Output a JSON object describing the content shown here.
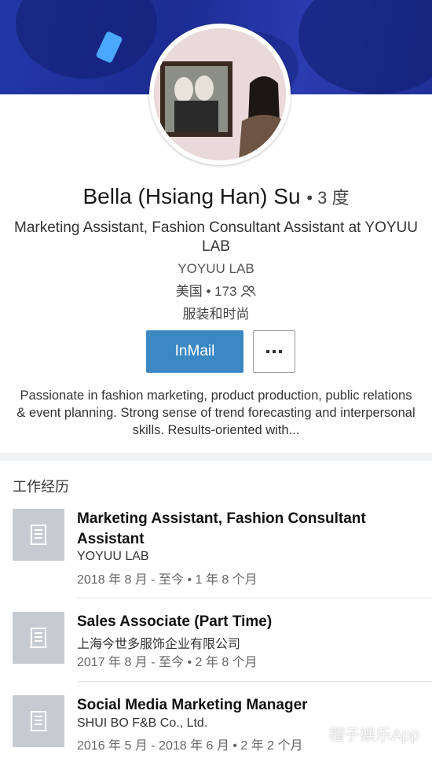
{
  "profile": {
    "name": "Bella (Hsiang Han) Su",
    "degree": "• 3 度",
    "headline": "Marketing Assistant, Fashion Consultant Assistant at YOYUU LAB",
    "company": "YOYUU LAB",
    "location": "美国 • 173",
    "industry": "服装和时尚",
    "summary": "Passionate in fashion marketing, product production, public relations & event planning. Strong sense of trend forecasting and interpersonal skills. Results-oriented with..."
  },
  "actions": {
    "inmail_label": "InMail"
  },
  "experience": {
    "section_title": "工作经历",
    "items": [
      {
        "title": "Marketing Assistant, Fashion Consultant Assistant",
        "company": "YOYUU LAB",
        "dates": "2018 年 8 月 - 至今 • 1 年 8 个月"
      },
      {
        "title": "Sales Associate (Part Time)",
        "company": "上海今世多服饰企业有限公司",
        "dates": "2017 年 8 月 - 至今 • 2 年 8 个月"
      },
      {
        "title": "Social Media Marketing Manager",
        "company": "SHUI BO F&B Co., Ltd.",
        "dates": "2016 年 5 月 - 2018 年 6 月 • 2 年 2 个月"
      }
    ]
  },
  "watermark": "榴子娱乐App",
  "colors": {
    "accent": "#3b88c3",
    "cover": "#2437a8",
    "logo_placeholder": "#c6cbd1"
  }
}
